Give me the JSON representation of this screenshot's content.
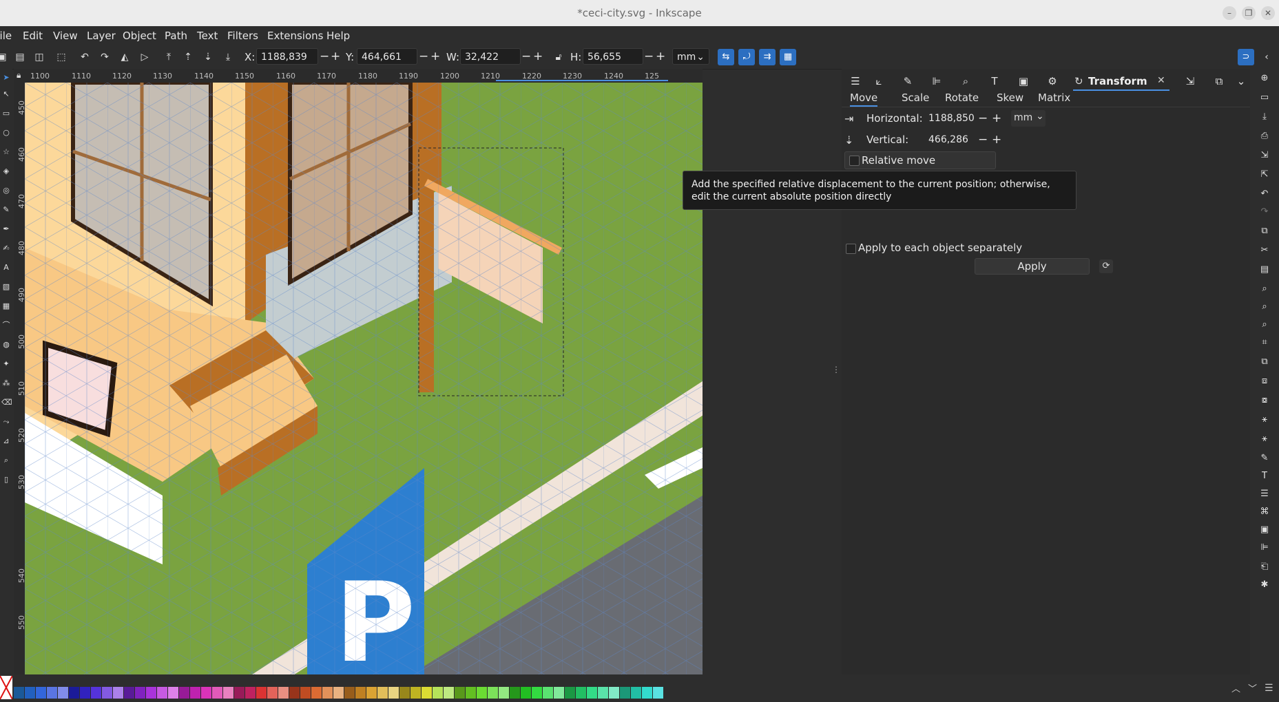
{
  "window": {
    "title": "*ceci-city.svg - Inkscape",
    "controls": [
      "–",
      "❐",
      "✕"
    ]
  },
  "menu": [
    "File",
    "Edit",
    "View",
    "Layer",
    "Object",
    "Path",
    "Text",
    "Filters",
    "Extensions",
    "Help"
  ],
  "toolbar": {
    "x_label": "X:",
    "x_value": "1188,839",
    "y_label": "Y:",
    "y_value": "464,661",
    "w_label": "W:",
    "w_value": "32,422",
    "h_label": "H:",
    "h_value": "56,655",
    "unit": "mm",
    "minus": "−",
    "plus": "+"
  },
  "ruler": {
    "h_ticks": [
      "1100",
      "1110",
      "1120",
      "1130",
      "1140",
      "1150",
      "1160",
      "1170",
      "1180",
      "1190",
      "1200",
      "1210",
      "1220",
      "1230",
      "1240",
      "125"
    ],
    "v_ticks": [
      "450",
      "460",
      "470",
      "480",
      "490",
      "500",
      "510",
      "520",
      "530",
      "540",
      "550"
    ]
  },
  "dock": {
    "active_tab": "Transform",
    "close": "✕",
    "subtabs": [
      "Move",
      "Scale",
      "Rotate",
      "Skew",
      "Matrix"
    ],
    "active_subtab": "Move",
    "horizontal_label": "Horizontal:",
    "horizontal_value": "1188,850",
    "vertical_label": "Vertical:",
    "vertical_value": "466,286",
    "unit": "mm",
    "relative_move_label": "Relative move",
    "relative_move_checked": false,
    "tooltip": "Add the specified relative displacement to the current position; otherwise, edit the current absolute position directly",
    "apply_each_label": "Apply to each object separately",
    "apply_each_checked": false,
    "apply_label": "Apply"
  },
  "colors": {
    "accent": "#2c6fc1",
    "grass": "#7aa340",
    "wall": "#fcd89a",
    "wood": "#b96f24"
  }
}
